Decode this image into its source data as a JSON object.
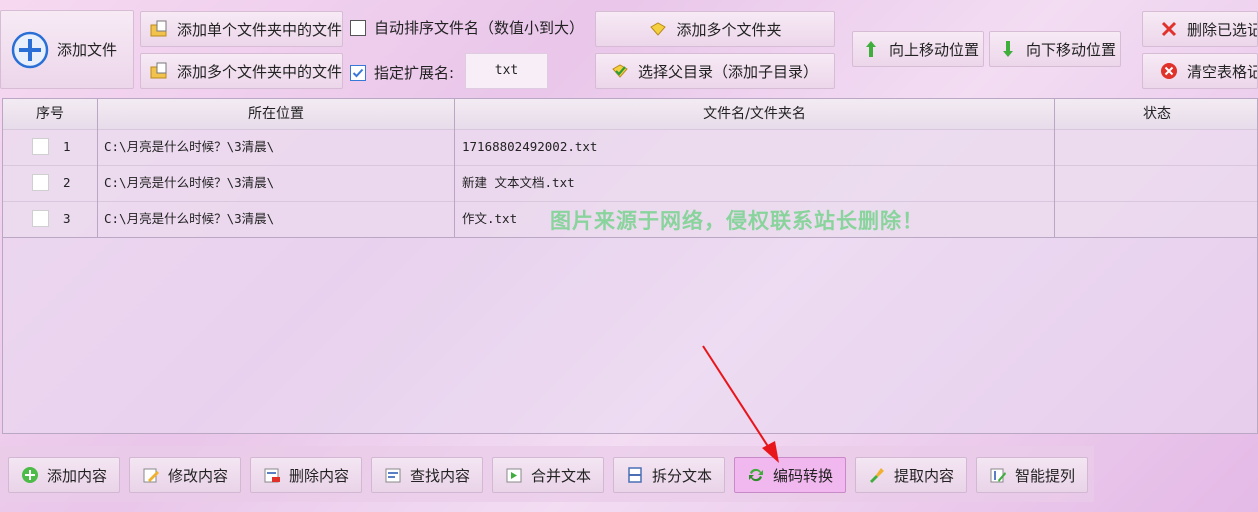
{
  "toolbar": {
    "add_file": "添加文件",
    "add_single_folder": "添加单个文件夹中的文件",
    "add_multi_folder_files": "添加多个文件夹中的文件",
    "auto_sort_label": "自动排序文件名（数值小到大）",
    "auto_sort_checked": false,
    "ext_label": "指定扩展名:",
    "ext_checked": true,
    "ext_value": "txt",
    "add_multi_folders": "添加多个文件夹",
    "select_parent": "选择父目录（添加子目录）",
    "move_up": "向上移动位置",
    "move_down": "向下移动位置",
    "delete_selected": "删除已选记",
    "clear_table": "清空表格记"
  },
  "table": {
    "columns": [
      "序号",
      "所在位置",
      "文件名/文件夹名",
      "状态"
    ],
    "rows": [
      {
        "num": "1",
        "location": "C:\\月亮是什么时候？\\3清晨\\",
        "name": "17168802492002.txt",
        "status": ""
      },
      {
        "num": "2",
        "location": "C:\\月亮是什么时候？\\3清晨\\",
        "name": "新建 文本文档.txt",
        "status": ""
      },
      {
        "num": "3",
        "location": "C:\\月亮是什么时候？\\3清晨\\",
        "name": "作文.txt",
        "status": ""
      }
    ]
  },
  "watermark": "图片来源于网络，侵权联系站长删除！",
  "bottom_buttons": [
    {
      "label": "添加内容",
      "icon": "add-circle-icon"
    },
    {
      "label": "修改内容",
      "icon": "edit-icon"
    },
    {
      "label": "删除内容",
      "icon": "delete-doc-icon"
    },
    {
      "label": "查找内容",
      "icon": "find-icon"
    },
    {
      "label": "合并文本",
      "icon": "merge-icon"
    },
    {
      "label": "拆分文本",
      "icon": "split-icon"
    },
    {
      "label": "编码转换",
      "icon": "convert-icon"
    },
    {
      "label": "提取内容",
      "icon": "extract-icon"
    },
    {
      "label": "智能提列",
      "icon": "smart-column-icon"
    }
  ],
  "colors": {
    "accent_blue": "#2a6fd6",
    "active_button": "#f1b7ef",
    "watermark_green": "#7fd494",
    "arrow_red": "#e8161b"
  }
}
